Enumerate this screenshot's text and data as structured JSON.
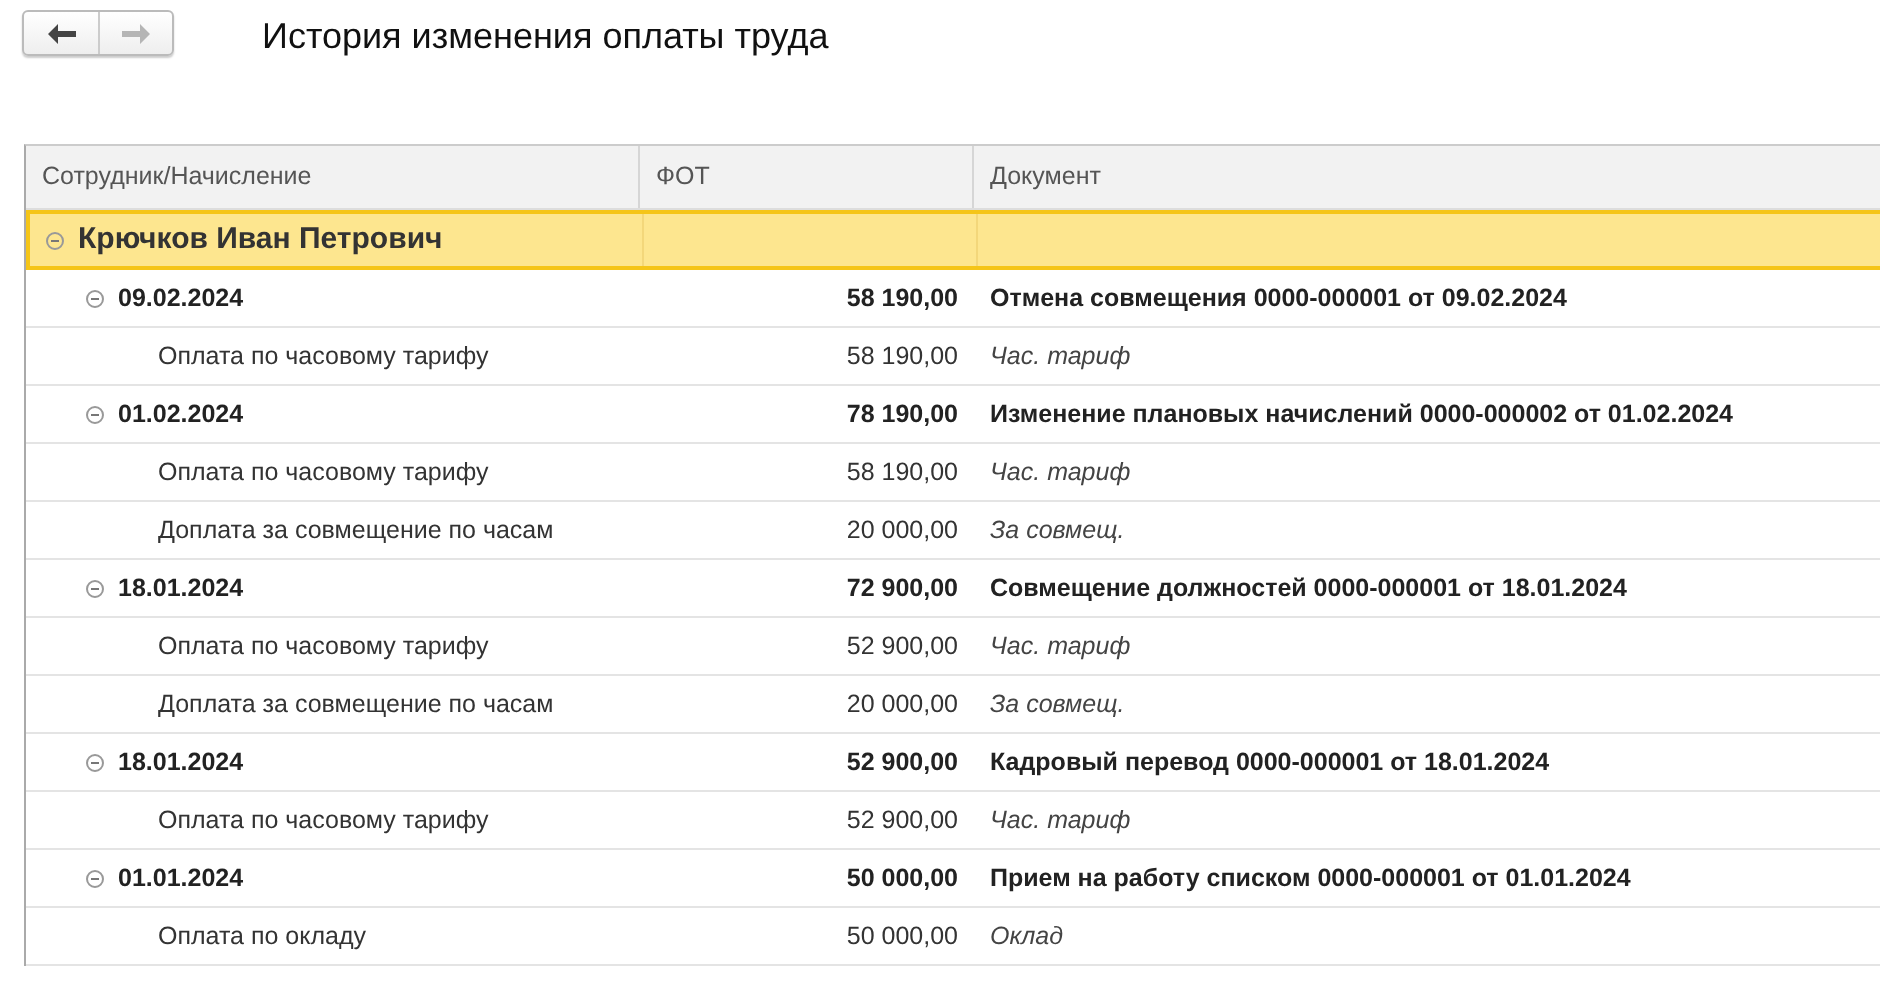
{
  "navigation": {
    "back": {
      "disabled": false
    },
    "forward": {
      "disabled": true
    }
  },
  "title": "История изменения оплаты труда",
  "table": {
    "columns": [
      "Сотрудник/Начисление",
      "ФОТ",
      "Документ"
    ],
    "rows": [
      {
        "name": "Крючков Иван Петрович",
        "selected": true,
        "expanded": true,
        "children": [
          {
            "name": "09.02.2024",
            "fot": "58 190,00",
            "document": "Отмена совмещения 0000-000001 от 09.02.2024",
            "expanded": true,
            "children": [
              {
                "name": "Оплата по часовому тарифу",
                "fot": "58 190,00",
                "document": "Час. тариф"
              }
            ]
          },
          {
            "name": "01.02.2024",
            "fot": "78 190,00",
            "document": "Изменение плановых начислений 0000-000002 от 01.02.2024",
            "expanded": true,
            "children": [
              {
                "name": "Оплата по часовому тарифу",
                "fot": "58 190,00",
                "document": "Час. тариф"
              },
              {
                "name": "Доплата за совмещение по часам",
                "fot": "20 000,00",
                "document": "За совмещ."
              }
            ]
          },
          {
            "name": "18.01.2024",
            "fot": "72 900,00",
            "document": "Совмещение должностей 0000-000001 от 18.01.2024",
            "expanded": true,
            "children": [
              {
                "name": "Оплата по часовому тарифу",
                "fot": "52 900,00",
                "document": "Час. тариф"
              },
              {
                "name": "Доплата за совмещение по часам",
                "fot": "20 000,00",
                "document": "За совмещ."
              }
            ]
          },
          {
            "name": "18.01.2024",
            "fot": "52 900,00",
            "document": "Кадровый перевод 0000-000001 от 18.01.2024",
            "expanded": true,
            "children": [
              {
                "name": "Оплата по часовому тарифу",
                "fot": "52 900,00",
                "document": "Час. тариф"
              }
            ]
          },
          {
            "name": "01.01.2024",
            "fot": "50 000,00",
            "document": "Прием на работу списком 0000-000001 от 01.01.2024",
            "expanded": true,
            "children": [
              {
                "name": "Оплата по окладу",
                "fot": "50 000,00",
                "document": "Оклад"
              }
            ]
          }
        ]
      }
    ]
  }
}
